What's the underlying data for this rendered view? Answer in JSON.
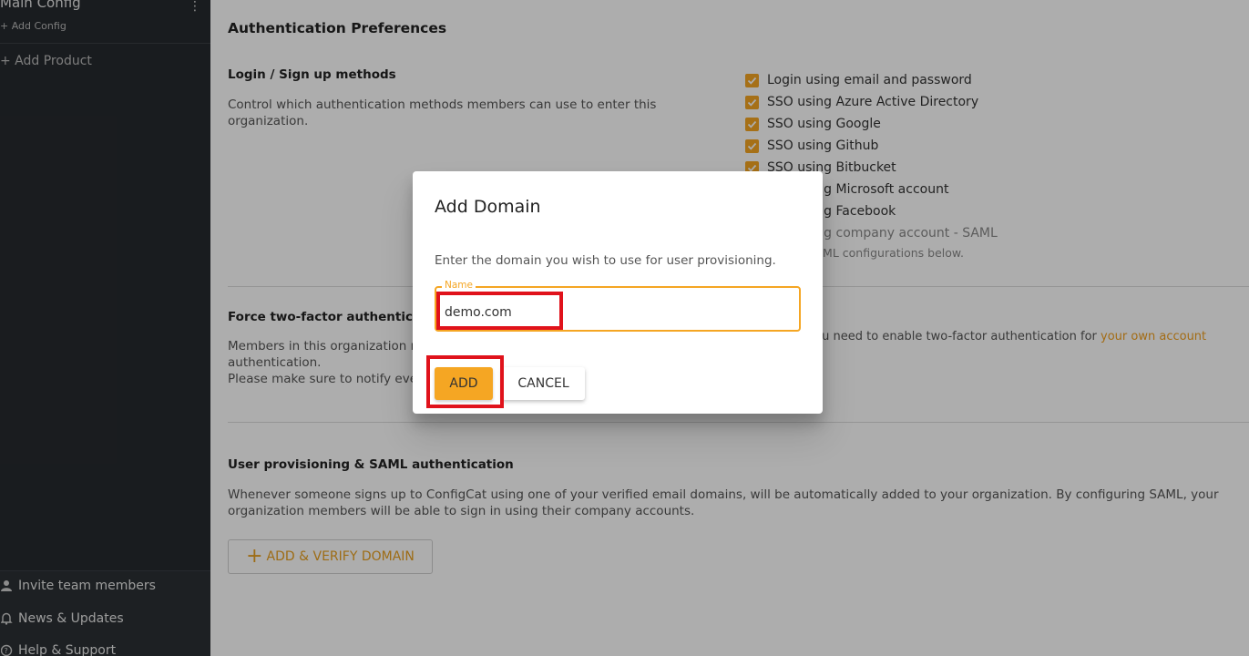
{
  "sidebar": {
    "config_name": "Main Config",
    "add_config": "+ Add Config",
    "add_product": "+ Add Product",
    "bottom_items": [
      {
        "label": "Invite team members",
        "icon": "person-icon"
      },
      {
        "label": "News & Updates",
        "icon": "bell-icon"
      },
      {
        "label": "Help & Support",
        "icon": "help-icon"
      }
    ]
  },
  "main": {
    "title": "Authentication Preferences",
    "login_section": {
      "title": "Login / Sign up methods",
      "description": "Control which authentication methods members can use to enter this organization.",
      "methods": [
        {
          "label": "Login using email and password",
          "checked": true
        },
        {
          "label": "SSO using Azure Active Directory",
          "checked": true
        },
        {
          "label": "SSO using Google",
          "checked": true
        },
        {
          "label": "SSO using Github",
          "checked": true
        },
        {
          "label": "SSO using Bitbucket",
          "checked": true
        },
        {
          "label": "SSO using Microsoft account",
          "checked": true
        },
        {
          "label": "SSO using Facebook",
          "checked": true
        },
        {
          "label": "SSO using company account - SAML",
          "checked": false
        }
      ],
      "saml_note": "Set up SAML configurations below."
    },
    "twofa_section": {
      "title": "Force two-factor authentication",
      "description_line1": "Members in this organization must use two-factor",
      "description_line2": "authentication.",
      "description_line3": "Please make sure to notify everyone",
      "right_text": "You need to enable two-factor authentication for",
      "right_link": "your own account"
    },
    "provisioning_section": {
      "title": "User provisioning & SAML authentication",
      "description": "Whenever someone signs up to ConfigCat using one of your verified email domains, will be automatically added to your organization. By configuring SAML, your organization members will be able to sign in using their company accounts.",
      "add_verify_label": "ADD & VERIFY DOMAIN"
    }
  },
  "dialog": {
    "title": "Add Domain",
    "text": "Enter the domain you wish to use for user provisioning.",
    "field_label": "Name",
    "field_value": "demo.com",
    "add_label": "ADD",
    "cancel_label": "CANCEL"
  },
  "colors": {
    "accent": "#f5a623",
    "sidebar_bg": "#262a2e",
    "highlight": "#e0121b"
  }
}
